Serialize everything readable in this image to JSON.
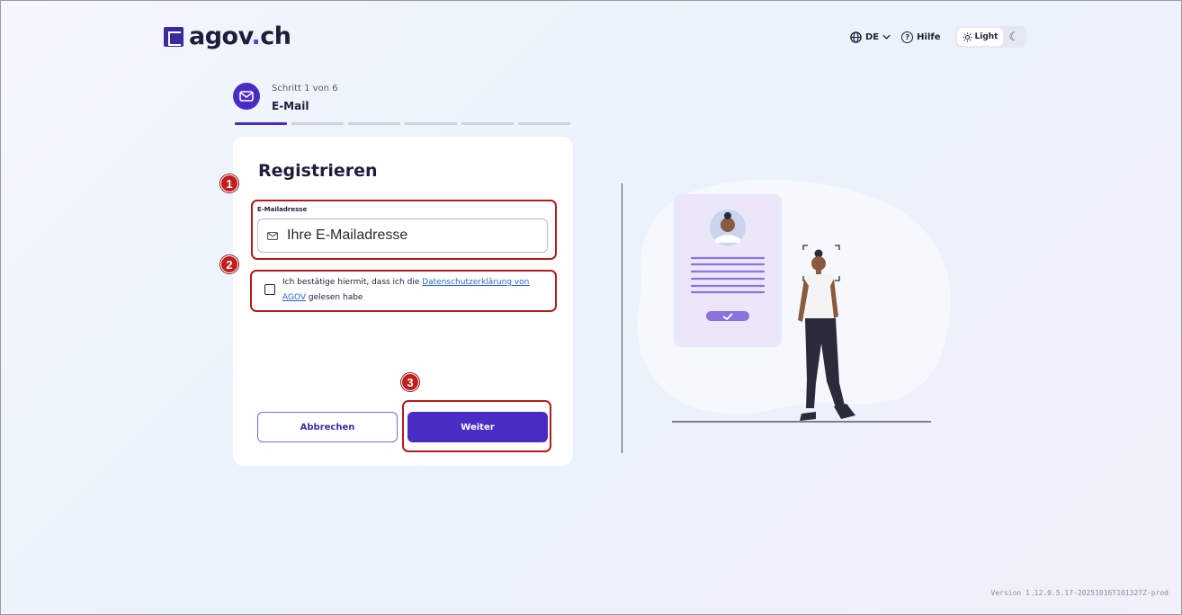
{
  "brand": {
    "logo_text_main": "agov",
    "logo_text_dot": ".",
    "logo_text_tld": "ch"
  },
  "header": {
    "language": "DE",
    "help": "Hilfe",
    "theme_light": "Light",
    "icons": {
      "language": "globe-icon",
      "help": "question-circle-icon",
      "light": "sun-icon",
      "dark": "moon-icon"
    }
  },
  "stepper": {
    "step_text": "Schritt 1 von 6",
    "step_title": "E-Mail",
    "total_steps": 6,
    "current_step": 1
  },
  "form": {
    "title": "Registrieren",
    "email_label": "E-Mailadresse",
    "email_placeholder": "Ihre E-Mailadresse",
    "email_value": "",
    "consent_text_before": "Ich bestätige hiermit, dass ich die ",
    "consent_link": "Datenschutzerklärung von AGOV",
    "consent_text_after": " gelesen habe",
    "consent_checked": false,
    "cancel_label": "Abbrechen",
    "next_label": "Weiter"
  },
  "annotations": {
    "badge_1": "1",
    "badge_2": "2",
    "badge_3": "3"
  },
  "footer": {
    "version": "Version 1.12.0.5.17-20251016T101327Z-prod"
  },
  "colors": {
    "primary": "#4a2cc4",
    "annotation": "#b11c1c",
    "link": "#2c63c9"
  }
}
